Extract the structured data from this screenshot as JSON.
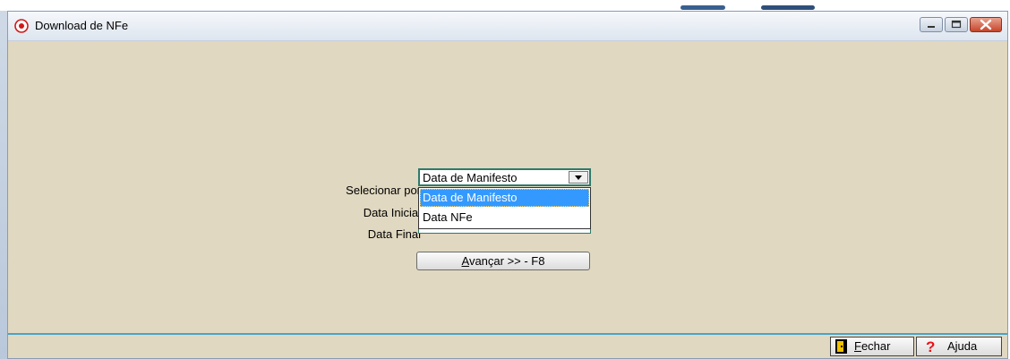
{
  "window": {
    "title": "Download de NFe"
  },
  "form": {
    "selecionar_label": "Selecionar por",
    "data_inicial_label": "Data Inicial",
    "data_final_label": "Data Final",
    "combo_value": "Data de Manifesto",
    "options": [
      {
        "label": "Data de Manifesto",
        "selected": true
      },
      {
        "label": "Data NFe",
        "selected": false
      }
    ],
    "next_button": {
      "accel": "A",
      "rest": "vançar >> - F8"
    }
  },
  "footer": {
    "close_accel": "F",
    "close_rest": "echar",
    "help_label": "Ajuda"
  },
  "colors": {
    "window_bg": "#e0d8c0",
    "selection": "#3399ff",
    "divider": "#4aa3c8"
  }
}
